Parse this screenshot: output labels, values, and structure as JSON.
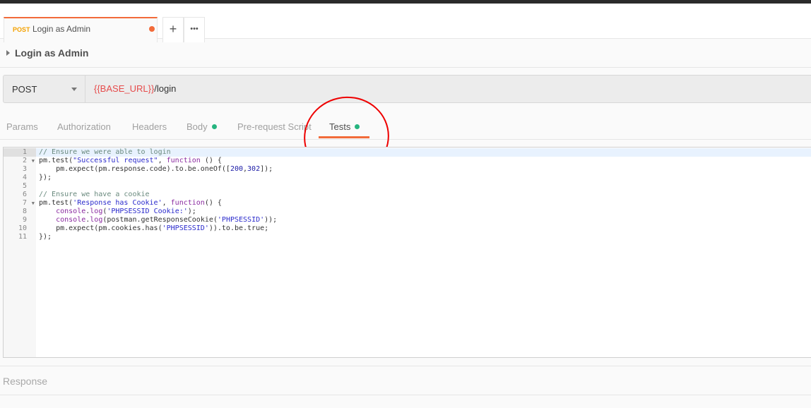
{
  "tab": {
    "method": "POST",
    "title": "Login as Admin",
    "unsaved_color": "#f26b3a",
    "new_tab_icon": "+",
    "more_icon": "•••"
  },
  "request": {
    "name": "Login as Admin",
    "method": "POST",
    "url_variable": "{{BASE_URL}}",
    "url_path": "/login"
  },
  "request_tabs": [
    {
      "label": "Params"
    },
    {
      "label": "Authorization"
    },
    {
      "label": "Headers"
    },
    {
      "label": "Body",
      "indicator": true
    },
    {
      "label": "Pre-request Script"
    },
    {
      "label": "Tests",
      "indicator": true,
      "active": true
    }
  ],
  "accent_color": "#f26b3a",
  "indicator_color": "#26b47f",
  "editor": {
    "lines": [
      {
        "n": "1",
        "t": [
          [
            "cm",
            "// Ensure we were able to login"
          ]
        ]
      },
      {
        "n": "2",
        "fold": true,
        "t": [
          [
            "",
            "pm.test("
          ],
          [
            "st",
            "\"Successful request\""
          ],
          [
            "",
            ", "
          ],
          [
            "kw",
            "function"
          ],
          [
            "",
            " () {"
          ]
        ]
      },
      {
        "n": "3",
        "t": [
          [
            "",
            "    pm.expect(pm.response.code).to.be.oneOf(["
          ],
          [
            "nb",
            "200"
          ],
          [
            "",
            ","
          ],
          [
            "nb",
            "302"
          ],
          [
            "",
            "]);"
          ]
        ]
      },
      {
        "n": "4",
        "t": [
          [
            "",
            "});"
          ]
        ]
      },
      {
        "n": "5",
        "t": []
      },
      {
        "n": "6",
        "t": [
          [
            "cm",
            "// Ensure we have a cookie"
          ]
        ]
      },
      {
        "n": "7",
        "fold": true,
        "t": [
          [
            "",
            "pm.test("
          ],
          [
            "st",
            "'Response has Cookie'"
          ],
          [
            "",
            ", "
          ],
          [
            "kw",
            "function"
          ],
          [
            "",
            "() {"
          ]
        ]
      },
      {
        "n": "8",
        "t": [
          [
            "",
            "    "
          ],
          [
            "kw",
            "console"
          ],
          [
            "",
            "."
          ],
          [
            "kw",
            "log"
          ],
          [
            "",
            "("
          ],
          [
            "st",
            "'PHPSESSID Cookie:'"
          ],
          [
            "",
            ");"
          ]
        ]
      },
      {
        "n": "9",
        "t": [
          [
            "",
            "    "
          ],
          [
            "kw",
            "console"
          ],
          [
            "",
            "."
          ],
          [
            "kw",
            "log"
          ],
          [
            "",
            "(postman.getResponseCookie("
          ],
          [
            "st",
            "'PHPSESSID'"
          ],
          [
            "",
            "));"
          ]
        ]
      },
      {
        "n": "10",
        "t": [
          [
            "",
            "    pm.expect(pm.cookies.has("
          ],
          [
            "st",
            "'PHPSESSID'"
          ],
          [
            "",
            ")).to.be.true;"
          ]
        ]
      },
      {
        "n": "11",
        "t": [
          [
            "",
            "});"
          ]
        ]
      }
    ]
  },
  "response": {
    "label": "Response"
  }
}
